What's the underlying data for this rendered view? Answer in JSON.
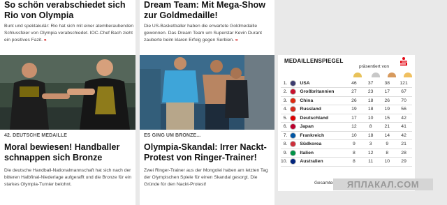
{
  "col1": {
    "top_title": "So schön verabschiedet sich Rio von Olympia",
    "top_text": "Bunt und spektakulär: Rio hat sich mit einer atemberaubenden Schlussfeier von Olympia verabschiedet. IOC-Chef Bach zieht ein positives Fazit.",
    "more": "»",
    "kicker": "42. DEUTSCHE MEDAILLE",
    "headline": "Moral bewiesen! Handballer schnappen sich Bronze",
    "teaser": "Die deutsche Handball-Nationalmannschaft hat sich nach der bitteren Halbfinal-Niederlage aufgerafft und die Bronze für ein starkes Olympia-Turnier belohnt."
  },
  "col2": {
    "top_title": "Dream Team: Mit Mega-Show zur Goldmedaille!",
    "top_text": "Die US-Basketballer haben die erwartete Goldmedaille gewonnen. Das Dream Team um Superstar Kevin Durant zauberte beim klaren Erfolg gegen Serbien.",
    "more": "»",
    "kicker": "ES GING UM BRONZE...",
    "headline": "Olympia-Skandal: Irrer Nackt-Protest von Ringer-Trainer!",
    "teaser": "Zwei Ringer-Trainer aus der Mongolei haben am letzten Tag der Olympischen Spiele für einen Skandal gesorgt. Die Gründe für den Nackt-Protest!"
  },
  "medals": {
    "title": "MEDAILLENSPIEGEL",
    "sponsor": "präsentiert von",
    "sponsor_icon": "sparkasse-logo-icon",
    "medal_colors": [
      "#e8c25a",
      "#c8c8c8",
      "#d79a5e",
      "#f0c060"
    ],
    "rows": [
      {
        "rank": "1.",
        "flag": "#3c3b6e",
        "country": "USA",
        "gold": "46",
        "silver": "37",
        "bronze": "38",
        "total": "121"
      },
      {
        "rank": "2.",
        "flag": "#c8102e",
        "country": "Großbritannien",
        "gold": "27",
        "silver": "23",
        "bronze": "17",
        "total": "67"
      },
      {
        "rank": "3.",
        "flag": "#de2910",
        "country": "China",
        "gold": "26",
        "silver": "18",
        "bronze": "26",
        "total": "70"
      },
      {
        "rank": "4.",
        "flag": "#d52b1e",
        "country": "Russland",
        "gold": "19",
        "silver": "18",
        "bronze": "19",
        "total": "56"
      },
      {
        "rank": "5.",
        "flag": "#dd0000",
        "country": "Deutschland",
        "gold": "17",
        "silver": "10",
        "bronze": "15",
        "total": "42"
      },
      {
        "rank": "6.",
        "flag": "#bc002d",
        "country": "Japan",
        "gold": "12",
        "silver": "8",
        "bronze": "21",
        "total": "41"
      },
      {
        "rank": "7.",
        "flag": "#0055a4",
        "country": "Frankreich",
        "gold": "10",
        "silver": "18",
        "bronze": "14",
        "total": "42"
      },
      {
        "rank": "8.",
        "flag": "#cd2e3a",
        "country": "Südkorea",
        "gold": "9",
        "silver": "3",
        "bronze": "9",
        "total": "21"
      },
      {
        "rank": "9.",
        "flag": "#009246",
        "country": "Italien",
        "gold": "8",
        "silver": "12",
        "bronze": "8",
        "total": "28"
      },
      {
        "rank": "10.",
        "flag": "#00247d",
        "country": "Australien",
        "gold": "8",
        "silver": "11",
        "bronze": "10",
        "total": "29"
      }
    ],
    "total_link": "Gesamter Medaillenspiegel"
  },
  "watermark": "ЯПЛАКАЛ.COM",
  "colors": {
    "accent": "#cc0000",
    "page_bg": "#e9e9e9"
  }
}
